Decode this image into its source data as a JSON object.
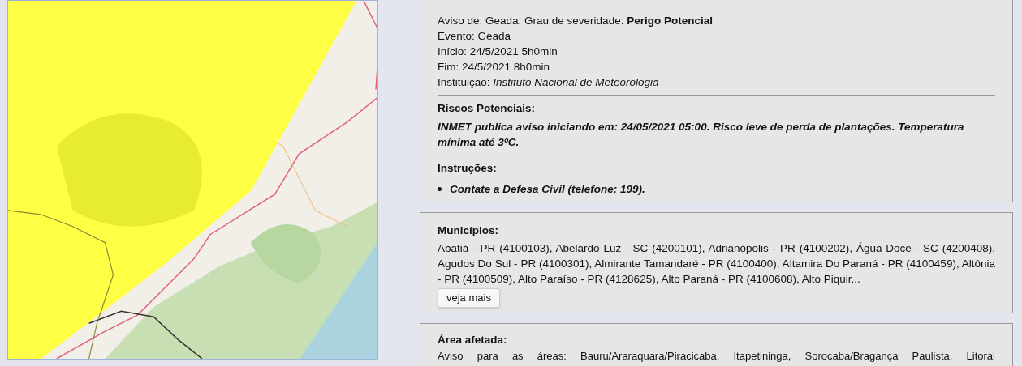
{
  "alert": {
    "lines": [
      "Aviso de: Geada. Grau de severidade: **Perigo Potencial**",
      "Evento: Geada",
      "Início: 24/5/2021 5h0min",
      "Fim: 24/5/2021 8h0min",
      "Instituição: *Instituto Nacional de Meteorologia*"
    ]
  },
  "risks": {
    "heading": "Riscos Potenciais:",
    "text": "INMET publica aviso iniciando em: 24/05/2021 05:00. Risco leve de perda de plantações. Temperatura mínima até 3ºC."
  },
  "instructions": {
    "heading": "Instruções:",
    "items": [
      "Contate a Defesa Civil (telefone: 199)."
    ]
  },
  "municipalities": {
    "heading": "Municípios:",
    "text": "Abatiá - PR (4100103), Abelardo Luz - SC (4200101), Adrianópolis - PR (4100202), Água Doce - SC (4200408), Agudos Do Sul - PR (4100301), Almirante Tamandaré - PR (4100400), Altamira Do Paraná - PR (4100459), Altônia - PR (4100509), Alto Paraíso - PR (4128625), Alto Paraná - PR (4100608), Alto Piquir...",
    "button": "veja mais"
  },
  "affected_area": {
    "heading": "Área afetada:",
    "text": "Aviso para as áreas: Bauru/Araraquara/Piracicaba, Itapetininga, Sorocaba/Bragança Paulista, Litoral"
  }
}
